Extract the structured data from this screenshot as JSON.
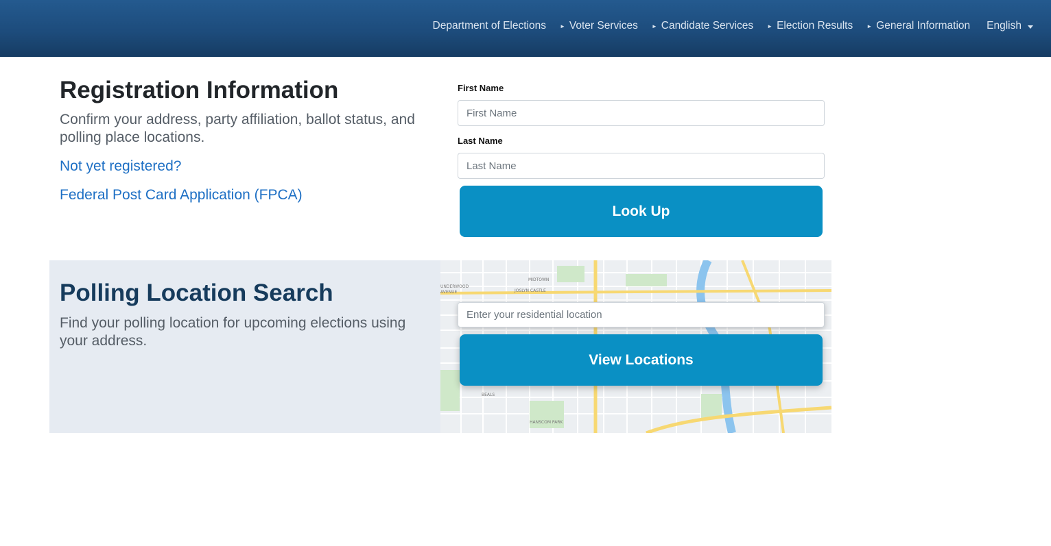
{
  "nav": {
    "items": [
      {
        "label": "Department of Elections"
      },
      {
        "label": "Voter Services"
      },
      {
        "label": "Candidate Services"
      },
      {
        "label": "Election Results"
      },
      {
        "label": "General Information"
      }
    ],
    "language": "English",
    "arrow_icon": "triangle-right-icon"
  },
  "registration": {
    "title": "Registration Information",
    "subtitle": "Confirm your address, party affiliation, ballot status, and polling place locations.",
    "link_register": "Not yet registered?",
    "link_fpca": "Federal Post Card Application (FPCA)",
    "first_name_label": "First Name",
    "first_name_placeholder": "First Name",
    "first_name_value": "",
    "last_name_label": "Last Name",
    "last_name_placeholder": "Last Name",
    "last_name_value": "",
    "lookup_button": "Look Up"
  },
  "polling": {
    "title": "Polling Location Search",
    "subtitle": "Find your polling location for upcoming elections using your address.",
    "location_placeholder": "Enter your residential location",
    "location_value": "",
    "view_button": "View Locations"
  },
  "map_labels": {
    "l1": "UNDERWOOD",
    "l2": "AVENUE",
    "l3": "MIDTOWN",
    "l4": "JOSLYN CASTLE",
    "l5": "BEALS",
    "l6": "HANSCOM PARK"
  },
  "colors": {
    "nav_bg": "#1d4c7c",
    "button_bg": "#0a90c4",
    "link": "#1d6fc4",
    "poll_bg": "#e6ebf2"
  }
}
